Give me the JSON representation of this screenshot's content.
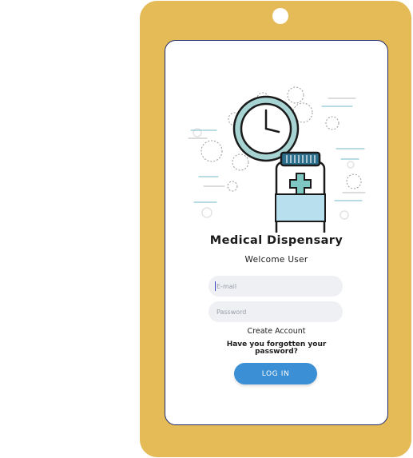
{
  "app": {
    "title": "Medical Dispensary",
    "subtitle": "Welcome User"
  },
  "form": {
    "email_placeholder": "E-mail",
    "email_value": "",
    "password_placeholder": "Password",
    "password_value": "",
    "create_account_label": "Create Account",
    "forgot_password_label": "Have you forgotten your password?",
    "login_label": "LOG IN"
  },
  "illustration": {
    "icons": [
      "clock-icon",
      "medicine-bottle-icon",
      "medical-cross-icon"
    ]
  },
  "colors": {
    "device_frame": "#e5bb58",
    "screen_border": "#1e2a6e",
    "button": "#3b8fd4",
    "input_bg": "#eef0f4",
    "clock_rim": "#9ecfcf",
    "bottle_cap": "#2b6f8c",
    "bottle_accent": "#b8dfee"
  }
}
